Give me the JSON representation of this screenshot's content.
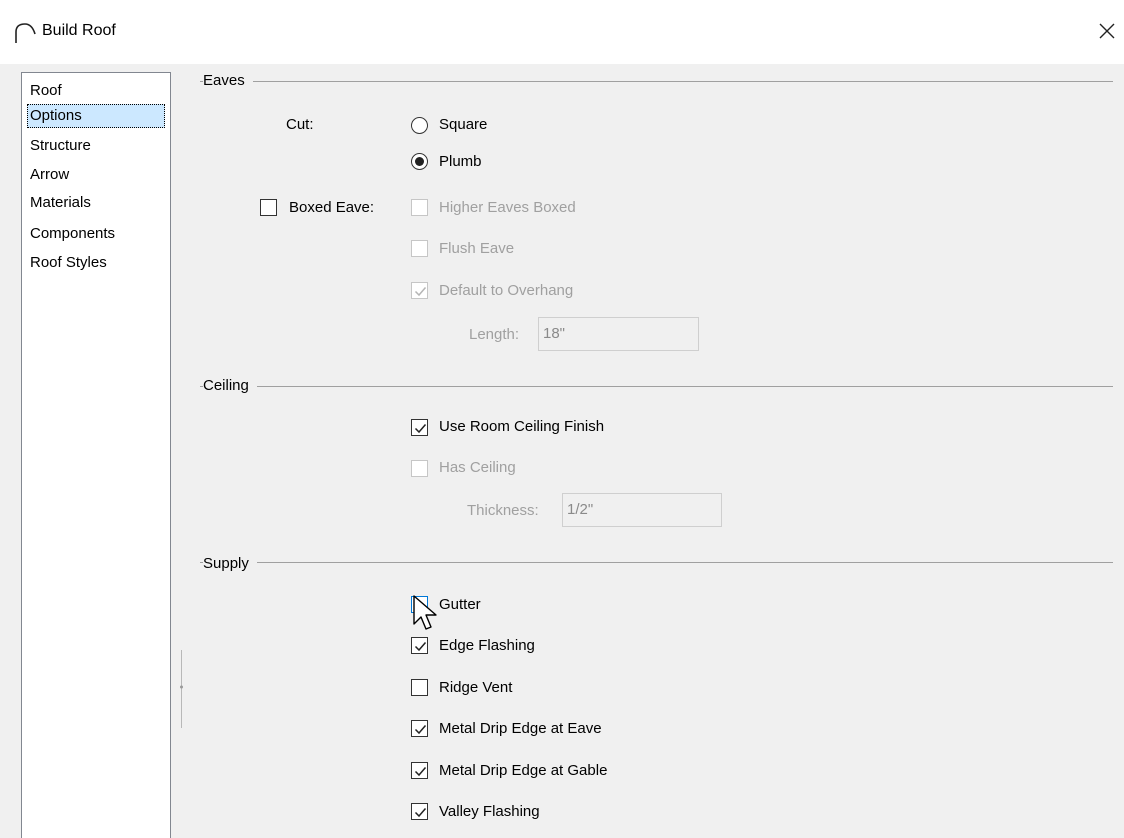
{
  "window": {
    "title": "Build Roof",
    "icon": "roof-arc-icon",
    "close_icon": "close-x-icon"
  },
  "nav": {
    "items": [
      {
        "label": "Roof",
        "selected": false
      },
      {
        "label": "Options",
        "selected": true
      },
      {
        "label": "Structure",
        "selected": false
      },
      {
        "label": "Arrow",
        "selected": false
      },
      {
        "label": "Materials",
        "selected": false
      },
      {
        "label": "Components",
        "selected": false
      },
      {
        "label": "Roof Styles",
        "selected": false
      }
    ]
  },
  "eaves": {
    "group_label": "Eaves",
    "cut_label": "Cut:",
    "cut_square": {
      "label": "Square",
      "selected": false
    },
    "cut_plumb": {
      "label": "Plumb",
      "selected": true
    },
    "boxed_eave": {
      "label": "Boxed Eave:",
      "checked": false
    },
    "higher_eaves_boxed": {
      "label": "Higher Eaves Boxed",
      "checked": false,
      "enabled": false
    },
    "flush_eave": {
      "label": "Flush Eave",
      "checked": false,
      "enabled": false
    },
    "default_to_overhang": {
      "label": "Default to Overhang",
      "checked": true,
      "enabled": false
    },
    "length": {
      "label": "Length:",
      "value": "18\""
    }
  },
  "ceiling": {
    "group_label": "Ceiling",
    "use_room_ceiling_finish": {
      "label": "Use Room Ceiling Finish",
      "checked": true
    },
    "has_ceiling": {
      "label": "Has Ceiling",
      "checked": false,
      "enabled": false
    },
    "thickness": {
      "label": "Thickness:",
      "value": "1/2\""
    }
  },
  "supply": {
    "group_label": "Supply",
    "gutter": {
      "label": "Gutter",
      "checked": false
    },
    "edge_flashing": {
      "label": "Edge Flashing",
      "checked": true
    },
    "ridge_vent": {
      "label": "Ridge Vent",
      "checked": false
    },
    "metal_drip_edge_eave": {
      "label": "Metal Drip Edge at Eave",
      "checked": true
    },
    "metal_drip_edge_gable": {
      "label": "Metal Drip Edge at Gable",
      "checked": true
    },
    "valley_flashing": {
      "label": "Valley Flashing",
      "checked": true
    }
  },
  "colors": {
    "selection_bg": "#cce8ff",
    "focus_border": "#0078d7",
    "disabled_text": "#a0a0a0"
  }
}
